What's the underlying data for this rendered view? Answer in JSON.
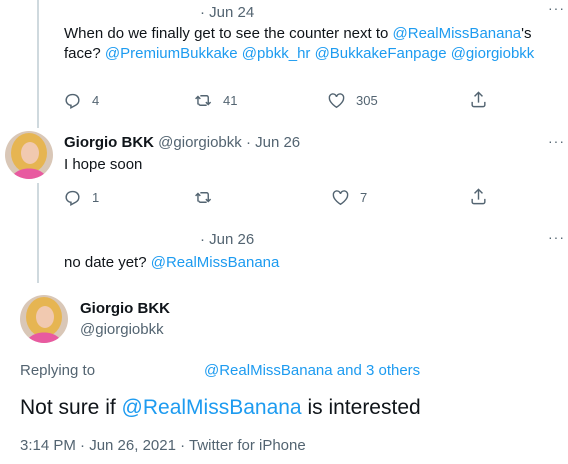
{
  "tweet1": {
    "dot_date": "· Jun 24",
    "text_prefix": "When do we finally get to see the counter next to ",
    "mention1": "@RealMissBanana",
    "text_suffix": "'s",
    "line2_prefix": "face? ",
    "mentions": "@PremiumBukkake @pbkk_hr @BukkakeFanpage @giorgiobkk",
    "replies": "4",
    "retweets": "41",
    "likes": "305",
    "more": "···"
  },
  "tweet2": {
    "name": "Giorgio BKK",
    "handle": "@giorgiobkk · Jun 26",
    "text": "I hope soon",
    "replies": "1",
    "likes": "7",
    "more": "···"
  },
  "tweet3": {
    "dot_date": "· Jun 26",
    "text_prefix": "no date yet? ",
    "mention": "@RealMissBanana",
    "more": "···"
  },
  "main": {
    "name": "Giorgio BKK",
    "handle": "@giorgiobkk",
    "replying_to_label": "Replying to",
    "replying_to_link": "@RealMissBanana and 3 others",
    "text_prefix": "Not sure if ",
    "mention": "@RealMissBanana",
    "text_suffix": " is interested",
    "meta": "3:14 PM · Jun 26, 2021 · Twitter for iPhone"
  },
  "icons": {
    "reply": "reply-icon",
    "retweet": "retweet-icon",
    "like": "heart-icon",
    "share": "share-icon",
    "more": "more-icon"
  },
  "colors": {
    "link": "#1d9bf0",
    "muted": "#536471",
    "line": "#cfd9de"
  }
}
